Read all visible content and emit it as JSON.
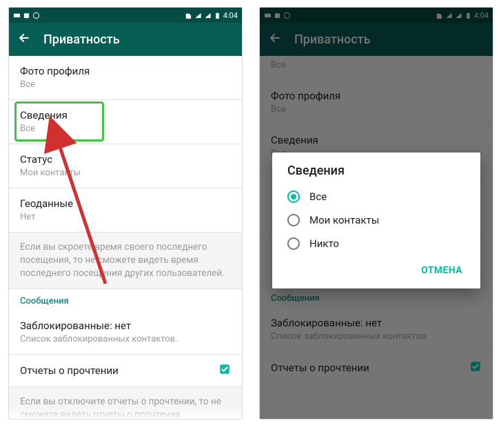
{
  "status": {
    "time": "4:04",
    "left_icons": [
      "youtube-icon",
      "calendar-icon",
      "whatsapp-icon"
    ],
    "right_icons": [
      "sim-icon",
      "signal-icon",
      "wifi-icon",
      "battery-icon"
    ]
  },
  "toolbar": {
    "title": "Приватность"
  },
  "settings": [
    {
      "key": "photo",
      "title": "Фото профиля",
      "sub": "Все"
    },
    {
      "key": "about",
      "title": "Сведения",
      "sub": "Все",
      "highlight": true
    },
    {
      "key": "status",
      "title": "Статус",
      "sub": "Мои контакты"
    },
    {
      "key": "geo",
      "title": "Геоданные",
      "sub": "Нет"
    }
  ],
  "info_text": "Если вы скроете время своего последнего посещения, то не сможете видеть время последнего посещения других пользователей.",
  "section_header": "Сообщения",
  "blocked": {
    "title": "Заблокированные: нет",
    "sub": "Список заблокированных контактов."
  },
  "read_receipts": {
    "title": "Отчеты о прочтении",
    "checked": true
  },
  "info_text2_partial": "Если вы отключите отчеты о прочтении, то не сможете видеть отчеты о прочтении",
  "dialog": {
    "title": "Сведения",
    "options": [
      {
        "label": "Все",
        "selected": true
      },
      {
        "label": "Мои контакты",
        "selected": false
      },
      {
        "label": "Никто",
        "selected": false
      }
    ],
    "cancel": "ОТМЕНА"
  }
}
